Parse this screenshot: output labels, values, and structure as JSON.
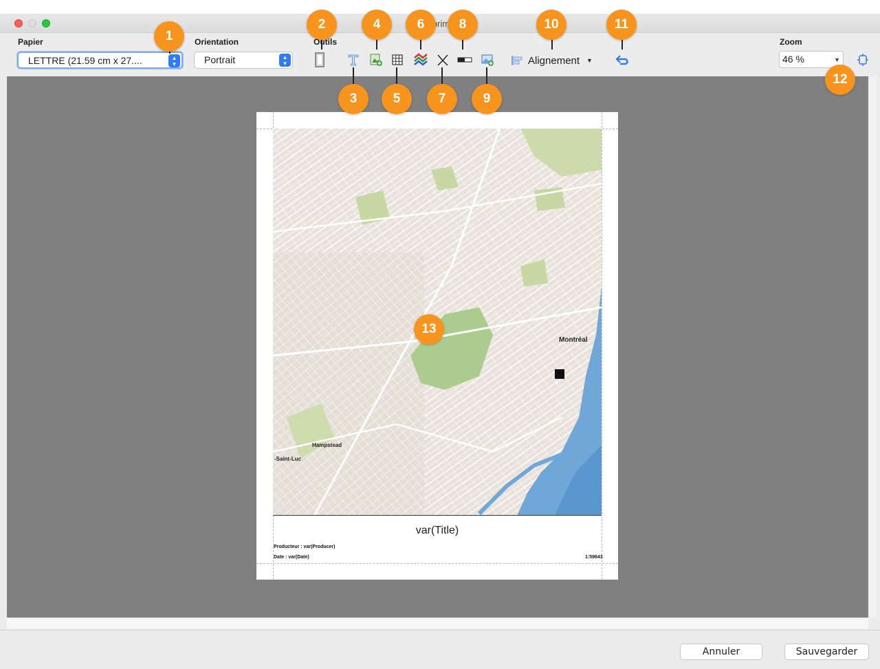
{
  "window": {
    "title": "Imprimer"
  },
  "toolbar": {
    "papier_label": "Papier",
    "papier_value": "LETTRE (21.59 cm x 27....",
    "orientation_label": "Orientation",
    "orientation_value": "Portrait",
    "outils_label": "Outils",
    "alignment_label": "Alignement",
    "zoom_label": "Zoom",
    "zoom_value": "46 %"
  },
  "tools": [
    {
      "name": "page-frame-icon"
    },
    {
      "name": "text-tool-icon"
    },
    {
      "name": "add-image-icon"
    },
    {
      "name": "table-grid-icon"
    },
    {
      "name": "legend-layers-icon"
    },
    {
      "name": "north-arrow-icon"
    },
    {
      "name": "scale-bar-icon"
    },
    {
      "name": "add-map-icon"
    },
    {
      "name": "undo-icon"
    },
    {
      "name": "fit-page-icon"
    }
  ],
  "page": {
    "title": "var(Title)",
    "producer": "Producteur : var(Producer)",
    "date": "Date : var(Date)",
    "scale": "1:59643",
    "map_labels": [
      "Montréal",
      "Hampstead",
      "-Saint-Luc"
    ]
  },
  "callouts": [
    "1",
    "2",
    "3",
    "4",
    "5",
    "6",
    "7",
    "8",
    "9",
    "10",
    "11",
    "12",
    "13"
  ],
  "buttons": {
    "cancel": "Annuler",
    "save": "Sauvegarder"
  },
  "colors": {
    "accent": "#2f7bf6",
    "callout": "#f7941d",
    "canvas": "#808080"
  }
}
